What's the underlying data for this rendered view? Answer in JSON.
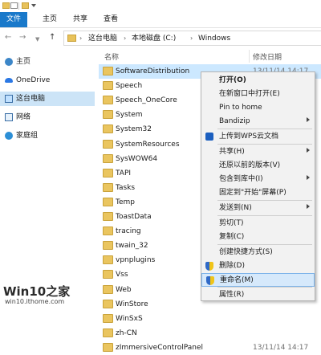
{
  "ribbon": {
    "tabs": [
      "文件",
      "主页",
      "共享",
      "查看"
    ]
  },
  "address": {
    "crumbs": [
      "这台电脑",
      "本地磁盘 (C:)",
      "Windows"
    ]
  },
  "sidebar": {
    "items": [
      "主页",
      "OneDrive",
      "这台电脑",
      "网络",
      "家庭组"
    ]
  },
  "columns": {
    "name": "名称",
    "modified": "修改日期"
  },
  "files": [
    {
      "name": "SoftwareDistribution",
      "date": "13/11/14 14:17"
    },
    {
      "name": "Speech",
      "date": ""
    },
    {
      "name": "Speech_OneCore",
      "date": ""
    },
    {
      "name": "System",
      "date": ""
    },
    {
      "name": "System32",
      "date": ""
    },
    {
      "name": "SystemResources",
      "date": ""
    },
    {
      "name": "SysWOW64",
      "date": ""
    },
    {
      "name": "TAPI",
      "date": ""
    },
    {
      "name": "Tasks",
      "date": ""
    },
    {
      "name": "Temp",
      "date": ""
    },
    {
      "name": "ToastData",
      "date": ""
    },
    {
      "name": "tracing",
      "date": ""
    },
    {
      "name": "twain_32",
      "date": ""
    },
    {
      "name": "vpnplugins",
      "date": ""
    },
    {
      "name": "Vss",
      "date": ""
    },
    {
      "name": "Web",
      "date": ""
    },
    {
      "name": "WinStore",
      "date": ""
    },
    {
      "name": "WinSxS",
      "date": ""
    },
    {
      "name": "zh-CN",
      "date": ""
    },
    {
      "name": "zImmersiveControlPanel",
      "date": "13/11/14 14:17"
    }
  ],
  "context_menu": {
    "items": [
      {
        "label": "打开(O)"
      },
      {
        "label": "在新窗口中打开(E)"
      },
      {
        "label": "Pin to home"
      },
      {
        "label": "Bandizip"
      },
      {
        "label": "上传到WPS云文档"
      },
      {
        "label": "共享(H)"
      },
      {
        "label": "还原以前的版本(V)"
      },
      {
        "label": "包含到库中(I)"
      },
      {
        "label": "固定到\"开始\"屏幕(P)"
      },
      {
        "label": "发送到(N)"
      },
      {
        "label": "剪切(T)"
      },
      {
        "label": "复制(C)"
      },
      {
        "label": "创建快捷方式(S)"
      },
      {
        "label": "删除(D)"
      },
      {
        "label": "重命名(M)"
      },
      {
        "label": "属性(R)"
      }
    ]
  },
  "watermark": {
    "main": "Win10之家",
    "sub": "win10.ithome.com"
  },
  "colors": {
    "accent": "#1979ca",
    "selection": "#cce8ff",
    "highlight": "#d6e9fb"
  }
}
